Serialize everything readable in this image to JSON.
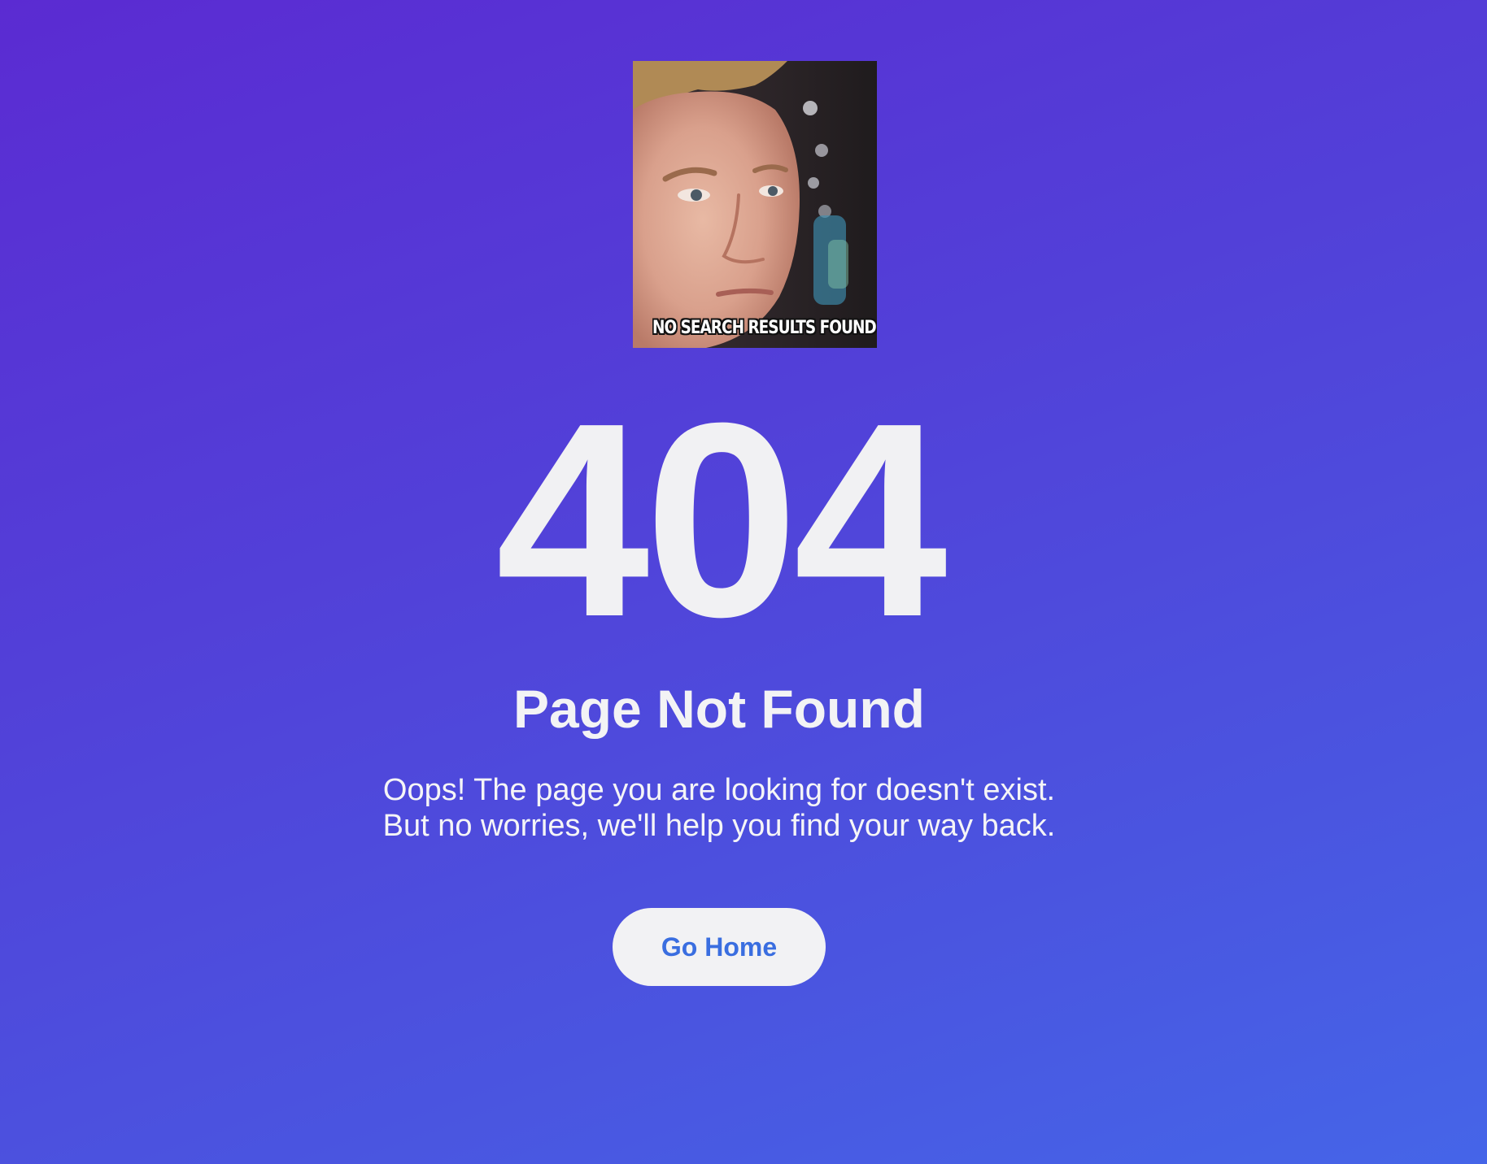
{
  "meme": {
    "caption": "NO SEARCH RESULTS FOUND",
    "icon": "blinking-guy-meme-image"
  },
  "error": {
    "code": "404",
    "title": "Page Not Found",
    "message_line1": "Oops! The page you are looking for doesn't exist.",
    "message_line2": "But no worries, we'll help you find your way back."
  },
  "actions": {
    "home_label": "Go Home"
  },
  "colors": {
    "background_start": "#5b2bd2",
    "background_end": "#4565e8",
    "text": "#f1f1f3",
    "button_bg": "#f2f2f4",
    "button_text": "#3a6ee0"
  }
}
